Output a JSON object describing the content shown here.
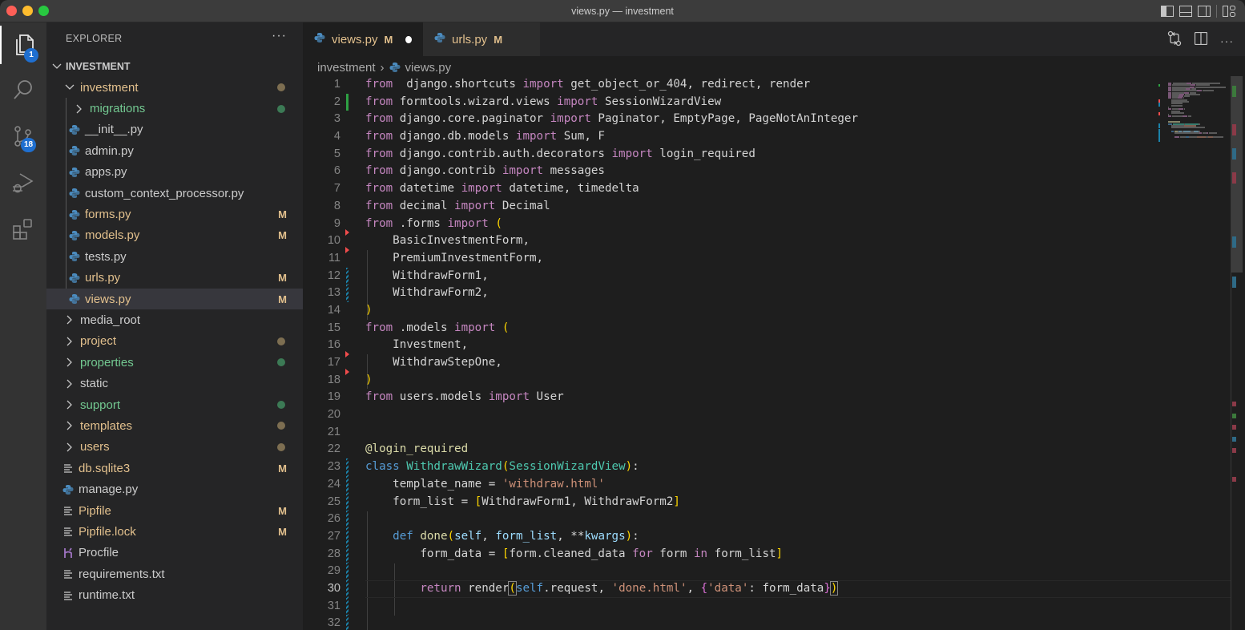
{
  "window": {
    "title": "views.py — investment"
  },
  "activity_bar": {
    "items": [
      {
        "name": "explorer",
        "icon": "files-icon",
        "badge": "1",
        "active": true
      },
      {
        "name": "search",
        "icon": "search-icon",
        "badge": null
      },
      {
        "name": "source-control",
        "icon": "source-control-icon",
        "badge": "18"
      },
      {
        "name": "run-debug",
        "icon": "run-debug-icon",
        "badge": null
      },
      {
        "name": "extensions",
        "icon": "extensions-icon",
        "badge": null
      }
    ]
  },
  "sidebar": {
    "header": "EXPLORER",
    "more_label": "···",
    "section_title": "INVESTMENT",
    "tree": [
      {
        "label": "investment",
        "type": "folder",
        "expanded": true,
        "depth": 1,
        "git": "mod-dot"
      },
      {
        "label": "migrations",
        "type": "folder",
        "expanded": false,
        "depth": 2,
        "git": "new-dot"
      },
      {
        "label": "__init__.py",
        "type": "python",
        "depth": 2,
        "git": ""
      },
      {
        "label": "admin.py",
        "type": "python",
        "depth": 2,
        "git": ""
      },
      {
        "label": "apps.py",
        "type": "python",
        "depth": 2,
        "git": ""
      },
      {
        "label": "custom_context_processor.py",
        "type": "python",
        "depth": 2,
        "git": ""
      },
      {
        "label": "forms.py",
        "type": "python",
        "depth": 2,
        "git": "M"
      },
      {
        "label": "models.py",
        "type": "python",
        "depth": 2,
        "git": "M"
      },
      {
        "label": "tests.py",
        "type": "python",
        "depth": 2,
        "git": ""
      },
      {
        "label": "urls.py",
        "type": "python",
        "depth": 2,
        "git": "M"
      },
      {
        "label": "views.py",
        "type": "python",
        "depth": 2,
        "git": "M",
        "selected": true
      },
      {
        "label": "media_root",
        "type": "folder",
        "expanded": false,
        "depth": 1,
        "git": ""
      },
      {
        "label": "project",
        "type": "folder",
        "expanded": false,
        "depth": 1,
        "git": "mod-dot"
      },
      {
        "label": "properties",
        "type": "folder",
        "expanded": false,
        "depth": 1,
        "git": "new-dot"
      },
      {
        "label": "static",
        "type": "folder",
        "expanded": false,
        "depth": 1,
        "git": ""
      },
      {
        "label": "support",
        "type": "folder",
        "expanded": false,
        "depth": 1,
        "git": "new-dot"
      },
      {
        "label": "templates",
        "type": "folder",
        "expanded": false,
        "depth": 1,
        "git": "mod-dot"
      },
      {
        "label": "users",
        "type": "folder",
        "expanded": false,
        "depth": 1,
        "git": "mod-dot"
      },
      {
        "label": "db.sqlite3",
        "type": "text",
        "depth": 1,
        "git": "M"
      },
      {
        "label": "manage.py",
        "type": "python",
        "depth": 1,
        "git": ""
      },
      {
        "label": "Pipfile",
        "type": "text",
        "depth": 1,
        "git": "M"
      },
      {
        "label": "Pipfile.lock",
        "type": "text",
        "depth": 1,
        "git": "M"
      },
      {
        "label": "Procfile",
        "type": "heroku",
        "depth": 1,
        "git": ""
      },
      {
        "label": "requirements.txt",
        "type": "text",
        "depth": 1,
        "git": ""
      },
      {
        "label": "runtime.txt",
        "type": "text",
        "depth": 1,
        "git": ""
      }
    ]
  },
  "tabs": [
    {
      "label": "views.py",
      "status": "M",
      "active": true,
      "dirty": true
    },
    {
      "label": "urls.py",
      "status": "M",
      "active": false,
      "dirty": false
    }
  ],
  "breadcrumb": [
    "investment",
    "views.py"
  ],
  "editor": {
    "current_line": 30,
    "lines": [
      {
        "n": "1",
        "tokens": [
          [
            "kw",
            "from"
          ],
          [
            "",
            "  django.shortcuts "
          ],
          [
            "kw",
            "import"
          ],
          [
            "",
            " get_object_or_404, redirect, render"
          ]
        ]
      },
      {
        "n": "2",
        "gutter": "add",
        "tokens": [
          [
            "kw",
            "from"
          ],
          [
            "",
            " formtools.wizard.views "
          ],
          [
            "kw",
            "import"
          ],
          [
            "",
            " SessionWizardView"
          ]
        ]
      },
      {
        "n": "3",
        "tokens": [
          [
            "kw",
            "from"
          ],
          [
            "",
            " django.core.paginator "
          ],
          [
            "kw",
            "import"
          ],
          [
            "",
            " Paginator, EmptyPage, PageNotAnInteger"
          ]
        ]
      },
      {
        "n": "4",
        "tokens": [
          [
            "kw",
            "from"
          ],
          [
            "",
            " django.db.models "
          ],
          [
            "kw",
            "import"
          ],
          [
            "",
            " Sum, F"
          ]
        ]
      },
      {
        "n": "5",
        "tokens": [
          [
            "kw",
            "from"
          ],
          [
            "",
            " django.contrib.auth.decorators "
          ],
          [
            "kw",
            "import"
          ],
          [
            "",
            " login_required"
          ]
        ]
      },
      {
        "n": "6",
        "tokens": [
          [
            "kw",
            "from"
          ],
          [
            "",
            " django.contrib "
          ],
          [
            "kw",
            "import"
          ],
          [
            "",
            " messages"
          ]
        ]
      },
      {
        "n": "7",
        "tokens": [
          [
            "kw",
            "from"
          ],
          [
            "",
            " datetime "
          ],
          [
            "kw",
            "import"
          ],
          [
            "",
            " datetime, timedelta"
          ]
        ]
      },
      {
        "n": "8",
        "tokens": [
          [
            "kw",
            "from"
          ],
          [
            "",
            " decimal "
          ],
          [
            "kw",
            "import"
          ],
          [
            "",
            " Decimal"
          ]
        ]
      },
      {
        "n": "9",
        "tokens": [
          [
            "kw",
            "from"
          ],
          [
            "",
            " .forms "
          ],
          [
            "kw",
            "import"
          ],
          [
            "",
            " "
          ],
          [
            "br1",
            "("
          ]
        ]
      },
      {
        "n": "10",
        "gutter": "del",
        "tokens": [
          [
            "",
            "    BasicInvestmentForm,"
          ]
        ]
      },
      {
        "n": "11",
        "gutter": "del",
        "tokens": [
          [
            "",
            "    PremiumInvestmentForm,"
          ]
        ]
      },
      {
        "n": "12",
        "gutter": "mod",
        "tokens": [
          [
            "",
            "    WithdrawForm1,"
          ]
        ]
      },
      {
        "n": "13",
        "gutter": "mod",
        "tokens": [
          [
            "",
            "    WithdrawForm2,"
          ]
        ]
      },
      {
        "n": "14",
        "tokens": [
          [
            "br1",
            ")"
          ]
        ]
      },
      {
        "n": "15",
        "tokens": [
          [
            "kw",
            "from"
          ],
          [
            "",
            " .models "
          ],
          [
            "kw",
            "import"
          ],
          [
            "",
            " "
          ],
          [
            "br1",
            "("
          ]
        ]
      },
      {
        "n": "16",
        "tokens": [
          [
            "",
            "    Investment,"
          ]
        ]
      },
      {
        "n": "17",
        "gutter": "del",
        "tokens": [
          [
            "",
            "    WithdrawStepOne,"
          ]
        ]
      },
      {
        "n": "18",
        "gutter": "del",
        "tokens": [
          [
            "br1",
            ")"
          ]
        ]
      },
      {
        "n": "19",
        "tokens": [
          [
            "kw",
            "from"
          ],
          [
            "",
            " users.models "
          ],
          [
            "kw",
            "import"
          ],
          [
            "",
            " User"
          ]
        ]
      },
      {
        "n": "20",
        "tokens": []
      },
      {
        "n": "21",
        "tokens": []
      },
      {
        "n": "22",
        "tokens": [
          [
            "dec",
            "@login_required"
          ]
        ]
      },
      {
        "n": "23",
        "gutter": "mod",
        "tokens": [
          [
            "kwb",
            "class"
          ],
          [
            "",
            " "
          ],
          [
            "cls",
            "WithdrawWizard"
          ],
          [
            "br1",
            "("
          ],
          [
            "cls",
            "SessionWizardView"
          ],
          [
            "br1",
            ")"
          ],
          [
            "",
            ":"
          ]
        ]
      },
      {
        "n": "24",
        "gutter": "mod",
        "tokens": [
          [
            "",
            "    template_name = "
          ],
          [
            "str",
            "'withdraw.html'"
          ]
        ]
      },
      {
        "n": "25",
        "gutter": "mod",
        "tokens": [
          [
            "",
            "    form_list = "
          ],
          [
            "br1",
            "["
          ],
          [
            "",
            "WithdrawForm1, WithdrawForm2"
          ],
          [
            "br1",
            "]"
          ]
        ]
      },
      {
        "n": "26",
        "gutter": "mod",
        "tokens": []
      },
      {
        "n": "27",
        "gutter": "mod",
        "tokens": [
          [
            "",
            "    "
          ],
          [
            "kwb",
            "def"
          ],
          [
            "",
            " "
          ],
          [
            "fn",
            "done"
          ],
          [
            "br1",
            "("
          ],
          [
            "par",
            "self"
          ],
          [
            "",
            ", "
          ],
          [
            "par",
            "form_list"
          ],
          [
            "",
            ", **"
          ],
          [
            "par",
            "kwargs"
          ],
          [
            "br1",
            ")"
          ],
          [
            "",
            ":"
          ]
        ]
      },
      {
        "n": "28",
        "gutter": "mod",
        "tokens": [
          [
            "",
            "        form_data = "
          ],
          [
            "br1",
            "["
          ],
          [
            "",
            "form.cleaned_data "
          ],
          [
            "kw",
            "for"
          ],
          [
            "",
            " form "
          ],
          [
            "kw",
            "in"
          ],
          [
            "",
            " form_list"
          ],
          [
            "br1",
            "]"
          ]
        ]
      },
      {
        "n": "29",
        "gutter": "mod",
        "tokens": []
      },
      {
        "n": "30",
        "gutter": "mod",
        "tokens": [
          [
            "",
            "        "
          ],
          [
            "kw",
            "return"
          ],
          [
            "",
            " render"
          ],
          [
            "br1 match",
            "("
          ],
          [
            "kwb",
            "self"
          ],
          [
            "",
            ".request, "
          ],
          [
            "str",
            "'done.html'"
          ],
          [
            "",
            ", "
          ],
          [
            "br2",
            "{"
          ],
          [
            "str",
            "'data'"
          ],
          [
            "",
            ": form_data"
          ],
          [
            "br2",
            "}"
          ],
          [
            "br1 match",
            ")"
          ]
        ]
      },
      {
        "n": "31",
        "gutter": "mod",
        "tokens": []
      },
      {
        "n": "32",
        "gutter": "mod",
        "tokens": []
      }
    ]
  },
  "colors": {
    "accent_badge": "#1f6fd0",
    "git_modified": "#e2c08d",
    "git_untracked": "#73c991",
    "gutter_added": "#2ea043",
    "gutter_modified": "#1b81a8",
    "gutter_deleted": "#f14c4c"
  }
}
